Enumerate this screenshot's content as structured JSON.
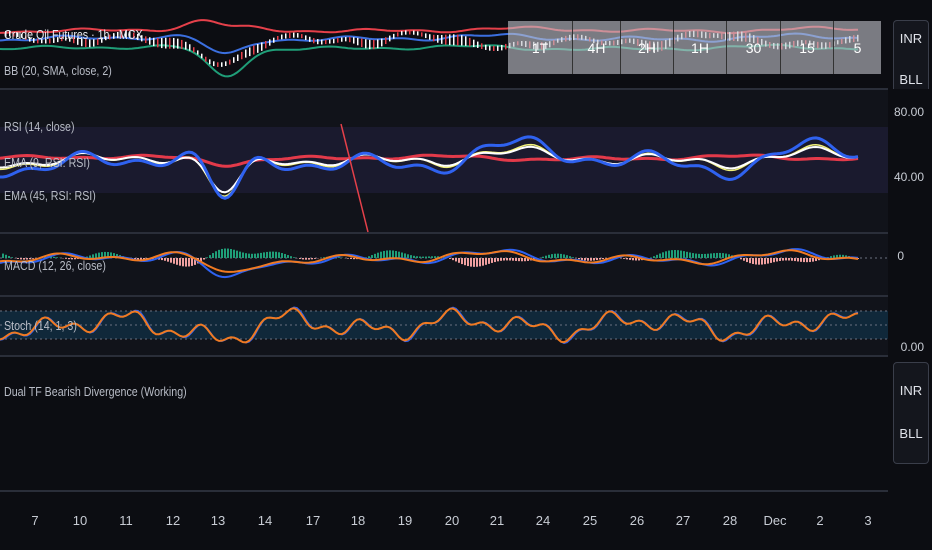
{
  "main": {
    "symbol": "Crude Oil Futures · 1h · MCX",
    "indicator": "BB (20, SMA, close, 2)",
    "tf_boxes": [
      "1T",
      "4H",
      "2H",
      "1H",
      "30",
      "15",
      "5"
    ]
  },
  "rsi": {
    "label": "RSI (14, close)",
    "ema1": "EMA (9, RSI: RSI)",
    "ema2": "EMA (45, RSI: RSI)",
    "ticks": [
      "80.00",
      "40.00"
    ]
  },
  "macd": {
    "label": "MACD (12, 26, close)",
    "tick": "0"
  },
  "stoch": {
    "label": "Stoch (14, 1, 3)",
    "tick": "0.00"
  },
  "bottom": {
    "label": "Dual TF Bearish Divergence (Working)"
  },
  "currency_buttons": {
    "top": [
      "INR",
      "BLL"
    ],
    "bottom": [
      "INR",
      "BLL"
    ]
  },
  "xaxis": [
    "7",
    "10",
    "11",
    "12",
    "13",
    "14",
    "17",
    "18",
    "19",
    "20",
    "21",
    "24",
    "25",
    "26",
    "27",
    "28",
    "Dec",
    "2",
    "3"
  ],
  "colors": {
    "upper": "#e5404a",
    "basis": "#3b6fe0",
    "lower": "#1f9e78",
    "rsi": "#2f62f0",
    "ema9": "#f2f27a",
    "ema45": "#e33a4a",
    "macd": "#2f62f0",
    "signal": "#f07a22"
  }
}
